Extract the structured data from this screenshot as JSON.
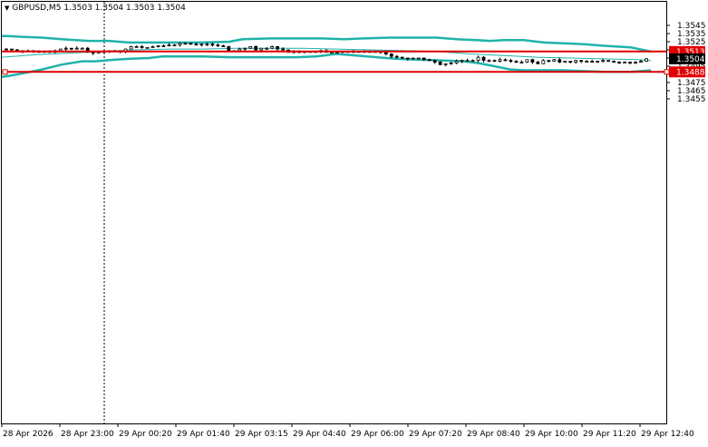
{
  "window": {
    "symbol_label": "GBPUSD,M5",
    "ohlc_label": "1.3503 1.3504 1.3503 1.3504"
  },
  "colors": {
    "background": "#ffffff",
    "candles": "#000000",
    "bollinger_bands": "#20b2aa",
    "moving_average": "#20b2aa",
    "level_lines": "#e00000",
    "current_price_box": "#000000"
  },
  "chart_data": {
    "type": "candlestick",
    "title": "GBPUSD,M5",
    "y_ticks": [
      "1.3545",
      "1.3535",
      "1.3525",
      "1.3515",
      "1.3505",
      "1.3495",
      "1.3485",
      "1.3475",
      "1.3465",
      "1.3455"
    ],
    "ylim": [
      1.34485,
      1.35495
    ],
    "x_ticks": [
      "28 Apr 2026",
      "28 Apr 23:00",
      "29 Apr 00:20",
      "29 Apr 01:40",
      "29 Apr 03:15",
      "29 Apr 04:40",
      "29 Apr 06:00",
      "29 Apr 07:20",
      "29 Apr 08:40",
      "29 Apr 10:00",
      "29 Apr 11:20",
      "29 Apr 12:40"
    ],
    "levels": [
      {
        "value": 1.3513,
        "label": "1.3513"
      },
      {
        "value": 1.3488,
        "label": "1.3488"
      }
    ],
    "current_price": {
      "value": 1.3504,
      "label": "1.3504"
    },
    "price_path": [
      1.3516,
      1.3515,
      1.3514,
      1.3513,
      1.3514,
      1.3513,
      1.3513,
      1.3513,
      1.3512,
      1.3514,
      1.3516,
      1.3517,
      1.3516,
      1.3517,
      1.3517,
      1.3512,
      1.3511,
      1.3513,
      1.3513,
      1.3514,
      1.3514,
      1.3513,
      1.3516,
      1.3519,
      1.3519,
      1.3518,
      1.3518,
      1.3519,
      1.352,
      1.352,
      1.3521,
      1.3521,
      1.3523,
      1.3523,
      1.3522,
      1.3521,
      1.3522,
      1.3522,
      1.3521,
      1.352,
      1.3519,
      1.3514,
      1.3514,
      1.3516,
      1.3517,
      1.3519,
      1.3515,
      1.3517,
      1.3517,
      1.3519,
      1.3516,
      1.3515,
      1.3512,
      1.3513,
      1.3513,
      1.3513,
      1.3513,
      1.3513,
      1.3514,
      1.3512,
      1.3512,
      1.3512,
      1.3513,
      1.3513,
      1.3513,
      1.3513,
      1.3513,
      1.3513,
      1.3513,
      1.3512,
      1.351,
      1.3507,
      1.3506,
      1.3505,
      1.3504,
      1.3505,
      1.3505,
      1.3503,
      1.3502,
      1.35,
      1.3497,
      1.3498,
      1.3499,
      1.3501,
      1.3502,
      1.3502,
      1.3502,
      1.3506,
      1.3502,
      1.3502,
      1.3501,
      1.3503,
      1.3502,
      1.3501,
      1.35,
      1.35,
      1.3503,
      1.35,
      1.3498,
      1.3502,
      1.3501,
      1.3503,
      1.35,
      1.3501,
      1.35,
      1.3502,
      1.3501,
      1.3501,
      1.35,
      1.3501,
      1.3502,
      1.3501,
      1.35,
      1.3499,
      1.35,
      1.3499,
      1.35,
      1.3501,
      1.3504
    ],
    "upper_band": [
      [
        0,
        1.3532
      ],
      [
        0.01,
        1.3532
      ],
      [
        0.03,
        1.3531
      ],
      [
        0.06,
        1.353
      ],
      [
        0.09,
        1.3528
      ],
      [
        0.13,
        1.3526
      ],
      [
        0.16,
        1.3526
      ],
      [
        0.19,
        1.3524
      ],
      [
        0.22,
        1.3524
      ],
      [
        0.26,
        1.3524
      ],
      [
        0.3,
        1.3524
      ],
      [
        0.34,
        1.3525
      ],
      [
        0.36,
        1.3528
      ],
      [
        0.4,
        1.3529
      ],
      [
        0.44,
        1.3529
      ],
      [
        0.48,
        1.3529
      ],
      [
        0.51,
        1.3528
      ],
      [
        0.54,
        1.3529
      ],
      [
        0.58,
        1.353
      ],
      [
        0.62,
        1.353
      ],
      [
        0.65,
        1.353
      ],
      [
        0.68,
        1.3528
      ],
      [
        0.71,
        1.3527
      ],
      [
        0.73,
        1.3526
      ],
      [
        0.75,
        1.3527
      ],
      [
        0.78,
        1.3527
      ],
      [
        0.81,
        1.3524
      ],
      [
        0.84,
        1.3523
      ],
      [
        0.87,
        1.3522
      ],
      [
        0.9,
        1.352
      ],
      [
        0.94,
        1.3518
      ],
      [
        0.97,
        1.3513
      ]
    ],
    "lower_band": [
      [
        0,
        1.3482
      ],
      [
        0.01,
        1.3483
      ],
      [
        0.03,
        1.3486
      ],
      [
        0.06,
        1.3491
      ],
      [
        0.09,
        1.3497
      ],
      [
        0.12,
        1.3501
      ],
      [
        0.14,
        1.3501
      ],
      [
        0.17,
        1.3503
      ],
      [
        0.19,
        1.3504
      ],
      [
        0.22,
        1.3505
      ],
      [
        0.24,
        1.3507
      ],
      [
        0.26,
        1.3507
      ],
      [
        0.3,
        1.3507
      ],
      [
        0.34,
        1.3506
      ],
      [
        0.36,
        1.3506
      ],
      [
        0.4,
        1.3506
      ],
      [
        0.44,
        1.3506
      ],
      [
        0.47,
        1.3507
      ],
      [
        0.5,
        1.351
      ],
      [
        0.53,
        1.3508
      ],
      [
        0.56,
        1.3506
      ],
      [
        0.59,
        1.3504
      ],
      [
        0.62,
        1.3503
      ],
      [
        0.66,
        1.3502
      ],
      [
        0.69,
        1.3501
      ],
      [
        0.71,
        1.3499
      ],
      [
        0.73,
        1.3496
      ],
      [
        0.76,
        1.3491
      ],
      [
        0.78,
        1.349
      ],
      [
        0.81,
        1.349
      ],
      [
        0.84,
        1.349
      ],
      [
        0.87,
        1.3489
      ],
      [
        0.9,
        1.3488
      ],
      [
        0.94,
        1.3488
      ],
      [
        0.97,
        1.349
      ]
    ],
    "moving_average": [
      [
        0,
        1.3506
      ],
      [
        0.05,
        1.3509
      ],
      [
        0.1,
        1.3511
      ],
      [
        0.15,
        1.3513
      ],
      [
        0.2,
        1.3515
      ],
      [
        0.25,
        1.3516
      ],
      [
        0.3,
        1.3516
      ],
      [
        0.35,
        1.3517
      ],
      [
        0.4,
        1.3517
      ],
      [
        0.45,
        1.3517
      ],
      [
        0.5,
        1.3516
      ],
      [
        0.55,
        1.3515
      ],
      [
        0.6,
        1.3514
      ],
      [
        0.65,
        1.3513
      ],
      [
        0.7,
        1.351
      ],
      [
        0.75,
        1.3508
      ],
      [
        0.8,
        1.3506
      ],
      [
        0.85,
        1.3505
      ],
      [
        0.9,
        1.3504
      ],
      [
        0.95,
        1.3503
      ],
      [
        0.97,
        1.3502
      ]
    ]
  }
}
